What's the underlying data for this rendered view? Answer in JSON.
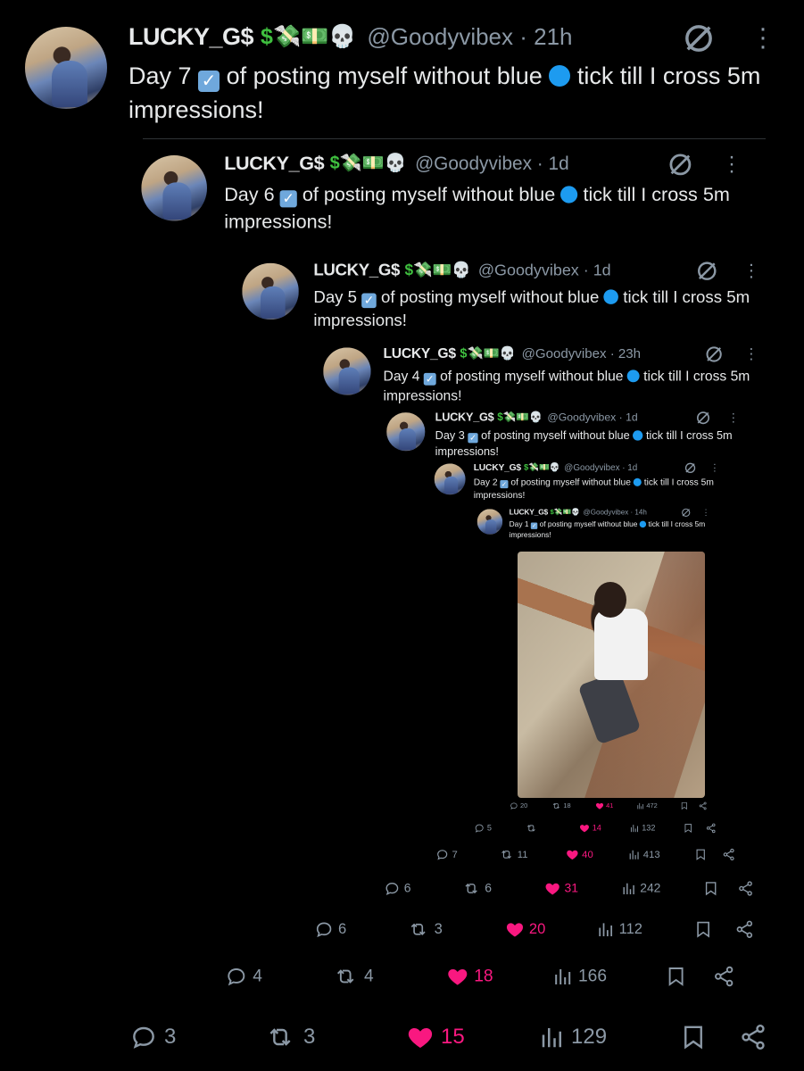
{
  "tweets": [
    {
      "level": 0,
      "name": "LUCKY_G$",
      "handle": "@Goodyvibex · 21h",
      "text_a": "Day 7",
      "text_b": "of posting myself without blue",
      "text_c": "tick till I cross 5m impressions!",
      "replies": "3",
      "reposts": "3",
      "likes": "15",
      "views": "129"
    },
    {
      "level": 1,
      "name": "LUCKY_G$",
      "handle": "@Goodyvibex · 1d",
      "text_a": "Day 6",
      "text_b": "of posting myself without blue",
      "text_c": "tick till I cross 5m impressions!",
      "replies": "4",
      "reposts": "4",
      "likes": "18",
      "views": "166"
    },
    {
      "level": 2,
      "name": "LUCKY_G$",
      "handle": "@Goodyvibex · 1d",
      "text_a": "Day 5",
      "text_b": "of posting myself without blue",
      "text_c": "tick till I cross 5m impressions!",
      "replies": "6",
      "reposts": "3",
      "likes": "20",
      "views": "112"
    },
    {
      "level": 3,
      "name": "LUCKY_G$",
      "handle": "@Goodyvibex · 23h",
      "text_a": "Day 4",
      "text_b": "of posting myself without blue",
      "text_c": "tick till I cross 5m impressions!",
      "replies": "6",
      "reposts": "6",
      "likes": "31",
      "views": "242"
    },
    {
      "level": 4,
      "name": "LUCKY_G$",
      "handle": "@Goodyvibex · 1d",
      "text_a": "Day 3",
      "text_b": "of posting myself without blue",
      "text_c": "tick till I cross 5m impressions!",
      "replies": "7",
      "reposts": "11",
      "likes": "40",
      "views": "413"
    },
    {
      "level": 5,
      "name": "LUCKY_G$",
      "handle": "@Goodyvibex · 1d",
      "text_a": "Day 2",
      "text_b": "of posting myself without blue",
      "text_c": "tick till I cross 5m impressions!",
      "replies": "5",
      "reposts": "",
      "likes": "14",
      "views": "132"
    },
    {
      "level": 6,
      "name": "LUCKY_G$",
      "handle": "@Goodyvibex · 14h",
      "text_a": "Day 1",
      "text_b": "of posting myself without blue",
      "text_c": "tick till I cross 5m impressions!",
      "replies": "20",
      "reposts": "18",
      "likes": "41",
      "views": "472"
    }
  ],
  "icons": {
    "emojis": "💸💵💀",
    "dollar": "$",
    "check": "✓",
    "grok": "grok-icon",
    "more": "more-vertical-icon"
  },
  "colors": {
    "like": "#f91880",
    "muted": "#8b98a5",
    "blue": "#1d9bf0",
    "check": "#6fa8dc",
    "dollar": "#3fbf3f"
  }
}
